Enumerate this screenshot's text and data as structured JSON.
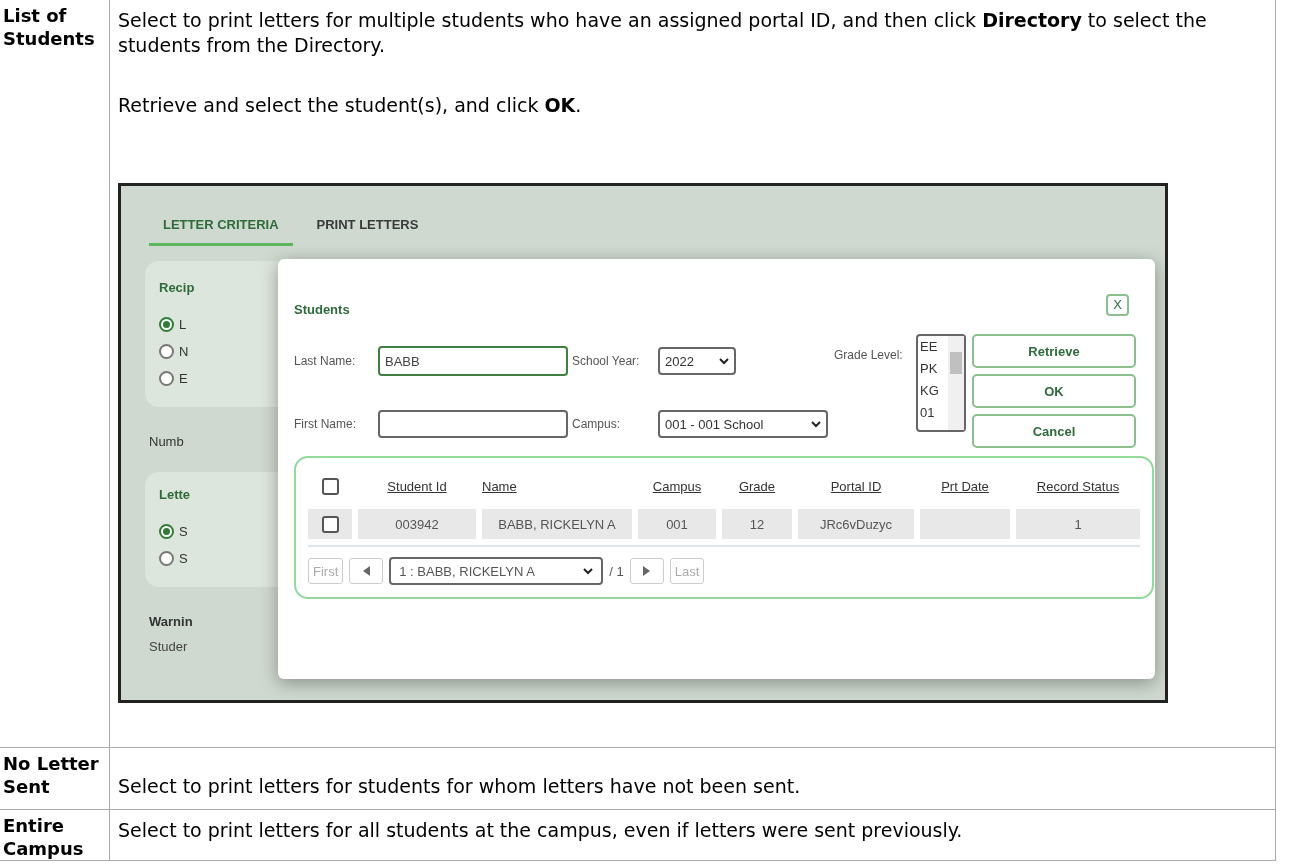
{
  "doc_table": {
    "rows": [
      {
        "term": "List of Students",
        "paragraphs": [
          "Select to print letters for multiple students who have an assigned portal ID, and then click **Directory** to select the students from the Directory.",
          "Retrieve and select the student(s), and click **OK**."
        ],
        "screenshot": {
          "tabs": [
            {
              "label": "LETTER CRITERIA",
              "selected": true
            },
            {
              "label": "PRINT LETTERS",
              "selected": false
            }
          ],
          "background": {
            "recipient_group": {
              "label": "Recip",
              "options": [
                {
                  "label": "L",
                  "selected": true
                },
                {
                  "label": "N",
                  "selected": false
                },
                {
                  "label": "E",
                  "selected": false
                }
              ]
            },
            "number_label": "Numb",
            "letter_group": {
              "label": "Lette",
              "options": [
                {
                  "label": "S",
                  "selected": true
                },
                {
                  "label": "S",
                  "selected": false
                }
              ]
            },
            "warning": {
              "title": "Warnin",
              "text": "Studer"
            }
          },
          "dialog": {
            "title": "Students",
            "close": "X",
            "last_name": {
              "label": "Last Name:",
              "value": "BABB"
            },
            "first_name": {
              "label": "First Name:"
            },
            "school_year": {
              "label": "School Year:",
              "value": "2022"
            },
            "campus": {
              "label": "Campus:",
              "value": "001 - 001 School"
            },
            "grade_level": {
              "label": "Grade Level:",
              "options": [
                "EE",
                "PK",
                "KG",
                "01"
              ]
            },
            "buttons": [
              "Retrieve",
              "OK",
              "Cancel"
            ],
            "results": {
              "select_all_checked": false,
              "columns": [
                "Student Id",
                "Name",
                "Campus",
                "Grade",
                "Portal ID",
                "Prt Date",
                "Record Status"
              ],
              "rows": [
                {
                  "checked": false,
                  "student_id": "003942",
                  "name": "BABB, RICKELYN A",
                  "campus": "001",
                  "grade": "12",
                  "portal_id": "JRc6vDuzyc",
                  "record_status": "1"
                }
              ],
              "pager": {
                "first": "First",
                "page": "1 : BABB, RICKELYN A",
                "total": "/ 1",
                "last": "Last"
              }
            }
          }
        }
      },
      {
        "term": "No Letter Sent",
        "paragraphs": [
          "Select to print letters for students for whom letters have not been sent."
        ]
      },
      {
        "term": "Entire Campus",
        "paragraphs": [
          "Select to print letters for all students at the campus, even if letters were sent previously."
        ]
      }
    ]
  }
}
